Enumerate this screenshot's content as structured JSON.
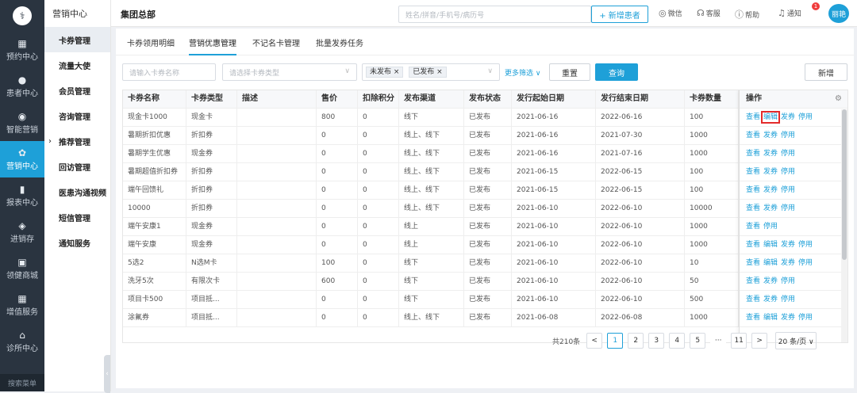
{
  "nav": {
    "logo": "⚕",
    "items": [
      {
        "label": "预约中心",
        "icon": "calendar-icon",
        "glyph": "▦"
      },
      {
        "label": "患者中心",
        "icon": "patient-icon",
        "glyph": "●"
      },
      {
        "label": "智能营销",
        "icon": "smart-marketing-icon",
        "glyph": "◉"
      },
      {
        "label": "营销中心",
        "icon": "marketing-icon",
        "glyph": "✿"
      },
      {
        "label": "报表中心",
        "icon": "report-icon",
        "glyph": "▮"
      },
      {
        "label": "进销存",
        "icon": "inventory-icon",
        "glyph": "◈"
      },
      {
        "label": "领健商城",
        "icon": "mall-icon",
        "glyph": "▣"
      },
      {
        "label": "增值服务",
        "icon": "value-added-icon",
        "glyph": "▦"
      },
      {
        "label": "诊所中心",
        "icon": "clinic-icon",
        "glyph": "⌂"
      }
    ],
    "search": "搜索菜单"
  },
  "subnav": {
    "title": "营销中心",
    "items": [
      {
        "label": "卡券管理"
      },
      {
        "label": "流量大使"
      },
      {
        "label": "会员管理"
      },
      {
        "label": "咨询管理"
      },
      {
        "label": "推荐管理"
      },
      {
        "label": "回访管理"
      },
      {
        "label": "医患沟通视频"
      },
      {
        "label": "短信管理"
      },
      {
        "label": "通知服务"
      }
    ]
  },
  "topbar": {
    "breadcrumb": "集团总部",
    "search_placeholder": "姓名/拼音/手机号/病历号",
    "add_patient": "+ 新增患者",
    "wechat": "微信",
    "service": "客服",
    "help": "帮助",
    "notify": "通知",
    "notify_count": "1",
    "avatar": "丽艳"
  },
  "tabs": [
    "卡券领用明细",
    "营销优惠管理",
    "不记名卡管理",
    "批量发券任务"
  ],
  "filters": {
    "name_placeholder": "请输入卡券名称",
    "type_placeholder": "请选择卡券类型",
    "status_tags": [
      "未发布",
      "已发布"
    ],
    "more": "更多筛选 ∨",
    "reset": "重置",
    "query": "查询",
    "add": "新增"
  },
  "table": {
    "columns": [
      "卡券名称",
      "卡券类型",
      "描述",
      "售价",
      "扣除积分",
      "发布渠道",
      "发布状态",
      "发行起始日期",
      "发行结束日期",
      "卡券数量"
    ],
    "ops_header": "操作",
    "rows": [
      {
        "c": [
          "现金卡1000",
          "现金卡",
          "",
          "800",
          "0",
          "线下",
          "已发布",
          "2021-06-16",
          "2022-06-16",
          "100"
        ],
        "ops": [
          "查看",
          "编辑",
          "发券",
          "停用"
        ]
      },
      {
        "c": [
          "暑期折扣优惠",
          "折扣券",
          "",
          "0",
          "0",
          "线上、线下",
          "已发布",
          "2021-06-16",
          "2021-07-30",
          "1000"
        ],
        "ops": [
          "查看",
          "发券",
          "停用"
        ]
      },
      {
        "c": [
          "暑期学生优惠",
          "现金券",
          "",
          "0",
          "0",
          "线上、线下",
          "已发布",
          "2021-06-16",
          "2021-07-16",
          "1000"
        ],
        "ops": [
          "查看",
          "发券",
          "停用"
        ]
      },
      {
        "c": [
          "暑期超值折扣券",
          "折扣券",
          "",
          "0",
          "0",
          "线上、线下",
          "已发布",
          "2021-06-15",
          "2022-06-15",
          "100"
        ],
        "ops": [
          "查看",
          "发券",
          "停用"
        ]
      },
      {
        "c": [
          "端午回馈礼",
          "折扣券",
          "",
          "0",
          "0",
          "线上、线下",
          "已发布",
          "2021-06-15",
          "2022-06-15",
          "100"
        ],
        "ops": [
          "查看",
          "发券",
          "停用"
        ]
      },
      {
        "c": [
          "10000",
          "折扣券",
          "",
          "0",
          "0",
          "线上、线下",
          "已发布",
          "2021-06-10",
          "2022-06-10",
          "10000"
        ],
        "ops": [
          "查看",
          "发券",
          "停用"
        ]
      },
      {
        "c": [
          "端午安康1",
          "现金券",
          "",
          "0",
          "0",
          "线上",
          "已发布",
          "2021-06-10",
          "2022-06-10",
          "1000"
        ],
        "ops": [
          "查看",
          "停用"
        ]
      },
      {
        "c": [
          "端午安康",
          "现金券",
          "",
          "0",
          "0",
          "线上",
          "已发布",
          "2021-06-10",
          "2022-06-10",
          "1000"
        ],
        "ops": [
          "查看",
          "编辑",
          "发券",
          "停用"
        ]
      },
      {
        "c": [
          "5选2",
          "N选M卡",
          "",
          "100",
          "0",
          "线下",
          "已发布",
          "2021-06-10",
          "2022-06-10",
          "10"
        ],
        "ops": [
          "查看",
          "编辑",
          "发券",
          "停用"
        ]
      },
      {
        "c": [
          "洗牙5次",
          "有限次卡",
          "",
          "600",
          "0",
          "线下",
          "已发布",
          "2021-06-10",
          "2022-06-10",
          "50"
        ],
        "ops": [
          "查看",
          "发券",
          "停用"
        ]
      },
      {
        "c": [
          "项目卡500",
          "项目抵...",
          "",
          "0",
          "0",
          "线下",
          "已发布",
          "2021-06-10",
          "2022-06-10",
          "500"
        ],
        "ops": [
          "查看",
          "发券",
          "停用"
        ]
      },
      {
        "c": [
          "涂氟券",
          "项目抵...",
          "",
          "0",
          "0",
          "线上、线下",
          "已发布",
          "2021-06-08",
          "2022-06-08",
          "1000"
        ],
        "ops": [
          "查看",
          "编辑",
          "发券",
          "停用"
        ]
      }
    ]
  },
  "pagination": {
    "total": "共210条",
    "pages": [
      "1",
      "2",
      "3",
      "4",
      "5",
      "···",
      "11"
    ],
    "prev": "<",
    "next": ">",
    "size": "20 条/页 ∨"
  },
  "colors": {
    "accent": "#1ea0d8",
    "nav_bg": "#2a3440",
    "highlight": "#e32b2b"
  }
}
